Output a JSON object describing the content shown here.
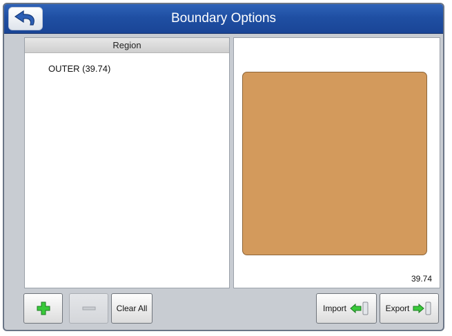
{
  "window": {
    "title": "Boundary Options"
  },
  "regions": {
    "header": "Region",
    "items": [
      {
        "label": "OUTER (39.74)"
      }
    ]
  },
  "preview": {
    "area_value": "39.74",
    "boundary_fill": "#d39a5c"
  },
  "toolbar": {
    "clear_all_label": "Clear All",
    "import_label": "Import",
    "export_label": "Export"
  },
  "icons": {
    "back": "back-arrow-icon",
    "add": "plus-icon",
    "remove": "minus-icon",
    "import": "import-arrow-icon",
    "export": "export-arrow-icon"
  }
}
